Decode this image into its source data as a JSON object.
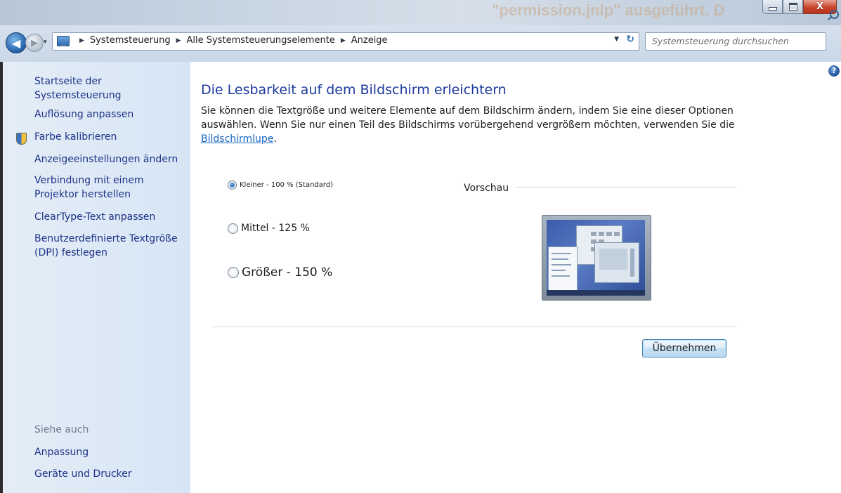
{
  "window": {
    "background_caption": "\"permission.jnlp\" ausgeführt. D",
    "minimize_glyph": "",
    "maximize_glyph": "",
    "close_glyph": "X"
  },
  "nav": {
    "back_glyph": "◀",
    "forward_glyph": "▶",
    "recent_glyph": "▾",
    "breadcrumbs": [
      {
        "label": "Systemsteuerung"
      },
      {
        "label": "Alle Systemsteuerungselemente"
      },
      {
        "label": "Anzeige"
      }
    ],
    "breadcrumb_separator": "▶",
    "dropdown_glyph": "▼",
    "refresh_glyph": "↻",
    "search_placeholder": "Systemsteuerung durchsuchen"
  },
  "sidebar": {
    "items": [
      {
        "label": "Startseite der Systemsteuerung"
      },
      {
        "label": "Auflösung anpassen"
      },
      {
        "label": "Farbe kalibrieren",
        "icon": "shield-icon"
      },
      {
        "label": "Anzeigeeinstellungen ändern"
      },
      {
        "label": "Verbindung mit einem Projektor herstellen"
      },
      {
        "label": "ClearType-Text anpassen"
      },
      {
        "label": "Benutzerdefinierte Textgröße (DPI) festlegen"
      }
    ],
    "see_also": {
      "heading": "Siehe auch",
      "items": [
        {
          "label": "Anpassung"
        },
        {
          "label": "Geräte und Drucker"
        }
      ]
    }
  },
  "main": {
    "help_glyph": "?",
    "heading": "Die Lesbarkeit auf dem Bildschirm erleichtern",
    "description": "Sie können die Textgröße und weitere Elemente auf dem Bildschirm ändern, indem Sie eine dieser Optionen auswählen. Wenn Sie nur einen Teil des Bildschirms vorübergehend vergrößern möchten, verwenden Sie die ",
    "description_link": "Bildschirmlupe",
    "description_end": ".",
    "options": [
      {
        "label": "Kleiner - 100 % (Standard)",
        "checked": true
      },
      {
        "label": "Mittel - 125 %",
        "checked": false
      },
      {
        "label": "Größer - 150 %",
        "checked": false
      }
    ],
    "preview_label": "Vorschau",
    "apply_label": "Übernehmen"
  },
  "colors": {
    "link": "#1e3287",
    "heading": "#1e3a9c",
    "sidebar_bg": "#dde9f6",
    "accent": "#3c7fb1"
  }
}
